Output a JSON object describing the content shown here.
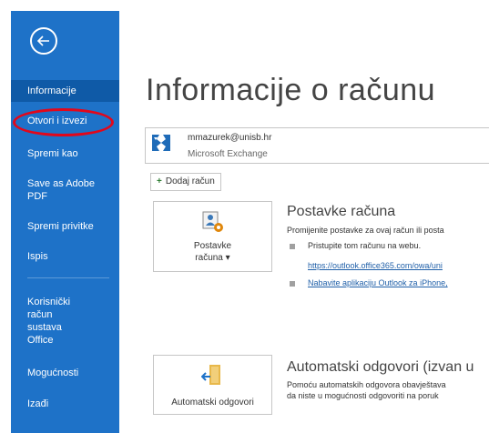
{
  "sidebar": {
    "items": [
      {
        "label": "Informacije"
      },
      {
        "label": "Otvori i izvezi"
      },
      {
        "label": "Spremi kao"
      },
      {
        "label": "Save as Adobe PDF"
      },
      {
        "label": "Spremi privitke"
      },
      {
        "label": "Ispis"
      },
      {
        "label": "Korisnički račun sustava Office"
      },
      {
        "label": "Mogućnosti"
      },
      {
        "label": "Izađi"
      }
    ],
    "accent": "#1e72c8",
    "highlight_color": "#e2071b"
  },
  "main": {
    "title": "Informacije o računu",
    "account": {
      "email": "mmazurek@unisb.hr",
      "type": "Microsoft Exchange"
    },
    "add_account_label": "Dodaj račun",
    "sections": [
      {
        "tile_label_line1": "Postavke",
        "tile_label_line2": "računa",
        "title": "Postavke računa",
        "desc": "Promijenite postavke za ovaj račun ili posta",
        "bullets": [
          {
            "text": "Pristupite tom računu na webu."
          },
          {
            "link": "https://outlook.office365.com/owa/uni"
          },
          {
            "link": "Nabavite aplikaciju Outlook za iPhone,"
          }
        ]
      },
      {
        "tile_label": "Automatski odgovori",
        "title": "Automatski odgovori (izvan u",
        "desc_line1": "Pomoću automatskih odgovora obavještava",
        "desc_line2": "da niste u mogućnosti odgovoriti na poruk"
      }
    ]
  }
}
